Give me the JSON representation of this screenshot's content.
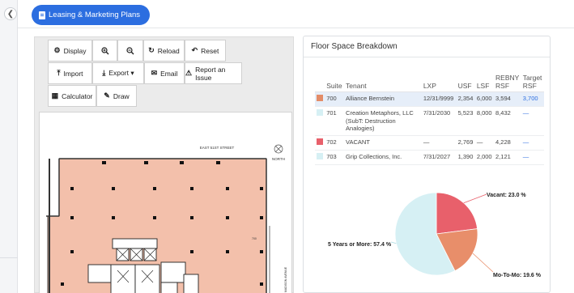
{
  "header": {
    "plans_button": "Leasing & Marketing Plans"
  },
  "toolbar": {
    "display": "Display",
    "reload": "Reload",
    "reset": "Reset",
    "import": "Import",
    "export": "Export ▾",
    "email": "Email",
    "report": "Report an Issue",
    "calculator": "Calculator",
    "draw": "Draw"
  },
  "floorplan": {
    "street_label": "EAST 51ST STREET",
    "north_label": "NORTH",
    "avenue_label": "MADISON AVENUE",
    "room_label": "700"
  },
  "breakdown": {
    "title": "Floor Space Breakdown",
    "columns": {
      "suite": "Suite",
      "tenant": "Tenant",
      "lxp": "LXP",
      "usf": "USF",
      "lsf": "LSF",
      "rebny": "REBNY RSF",
      "target": "Target RSF"
    },
    "rows": [
      {
        "color": "#e38c68",
        "suite": "700",
        "tenant": "Alliance Bernstein",
        "lxp": "12/31/9999",
        "usf": "2,354",
        "lsf": "6,000",
        "rebny": "3,594",
        "target": "3,700"
      },
      {
        "color": "#d6f0f4",
        "suite": "701",
        "tenant": "Creation Metaphors, LLC (SubT: Destruction Analogies)",
        "lxp": "7/31/2030",
        "usf": "5,523",
        "lsf": "8,000",
        "rebny": "8,432",
        "target": "—"
      },
      {
        "color": "#e8606b",
        "suite": "702",
        "tenant": "VACANT",
        "lxp": "—",
        "usf": "2,769",
        "lsf": "—",
        "rebny": "4,228",
        "target": "—"
      },
      {
        "color": "#d6f0f4",
        "suite": "703",
        "tenant": "Grip Collections, Inc.",
        "lxp": "7/31/2027",
        "usf": "1,390",
        "lsf": "2,000",
        "rebny": "2,121",
        "target": "—"
      }
    ]
  },
  "chart_data": {
    "type": "pie",
    "slices": [
      {
        "label": "Vacant: 23.0 %",
        "value": 23.0,
        "color": "#e8606b"
      },
      {
        "label": "Mo-To-Mo: 19.6 %",
        "value": 19.6,
        "color": "#e88e6a"
      },
      {
        "label": "5 Years or More: 57.4 %",
        "value": 57.4,
        "color": "#d6f0f4"
      }
    ]
  }
}
